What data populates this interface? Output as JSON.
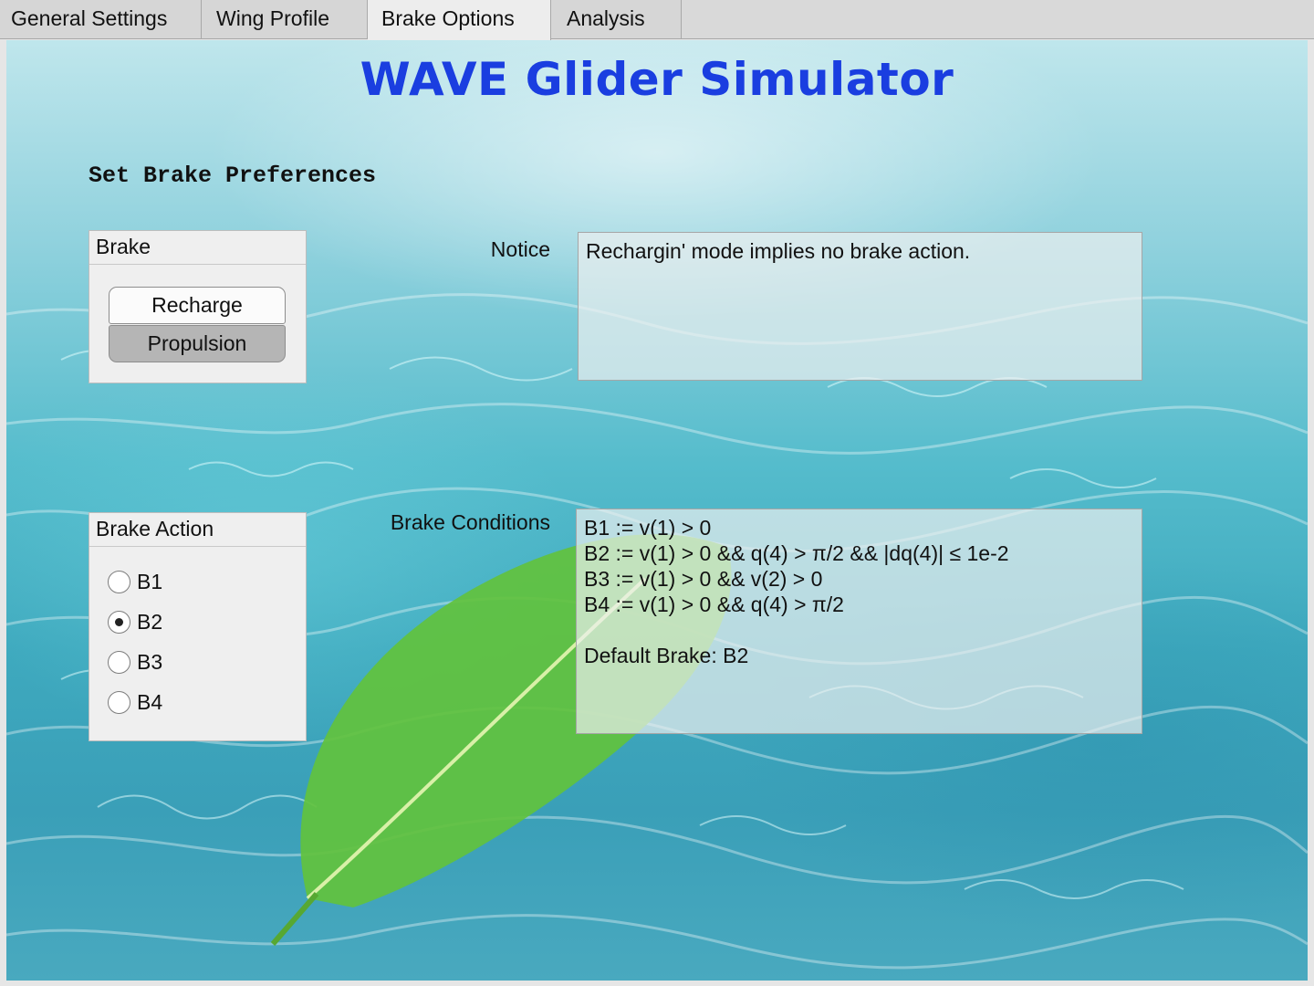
{
  "tabs": [
    {
      "label": "General Settings"
    },
    {
      "label": "Wing Profile"
    },
    {
      "label": "Brake Options"
    },
    {
      "label": "Analysis"
    }
  ],
  "active_tab": "Brake Options",
  "app_title": "WAVE Glider Simulator",
  "section_title": "Set Brake Preferences",
  "brake_group": {
    "title": "Brake",
    "buttons": [
      {
        "label": "Recharge",
        "selected": false
      },
      {
        "label": "Propulsion",
        "selected": true
      }
    ]
  },
  "notice": {
    "label": "Notice",
    "text": "Rechargin' mode implies no brake action."
  },
  "brake_action_group": {
    "title": "Brake Action",
    "options": [
      {
        "label": "B1",
        "checked": false
      },
      {
        "label": "B2",
        "checked": true
      },
      {
        "label": "B3",
        "checked": false
      },
      {
        "label": "B4",
        "checked": false
      }
    ]
  },
  "brake_conditions": {
    "label": "Brake Conditions",
    "lines": [
      "B1 := v(1) > 0",
      "B2 := v(1) > 0 && q(4) > π/2 && |dq(4)| ≤ 1e-2",
      "B3 := v(1) > 0 && v(2) > 0",
      "B4 := v(1) > 0 && q(4) > π/2"
    ],
    "default_line": "Default Brake: B2"
  },
  "colors": {
    "title": "#1a3ee0",
    "water_light": "#bfe6ec",
    "water_deep": "#3a9fb8",
    "leaf": "#5fbf3a"
  }
}
